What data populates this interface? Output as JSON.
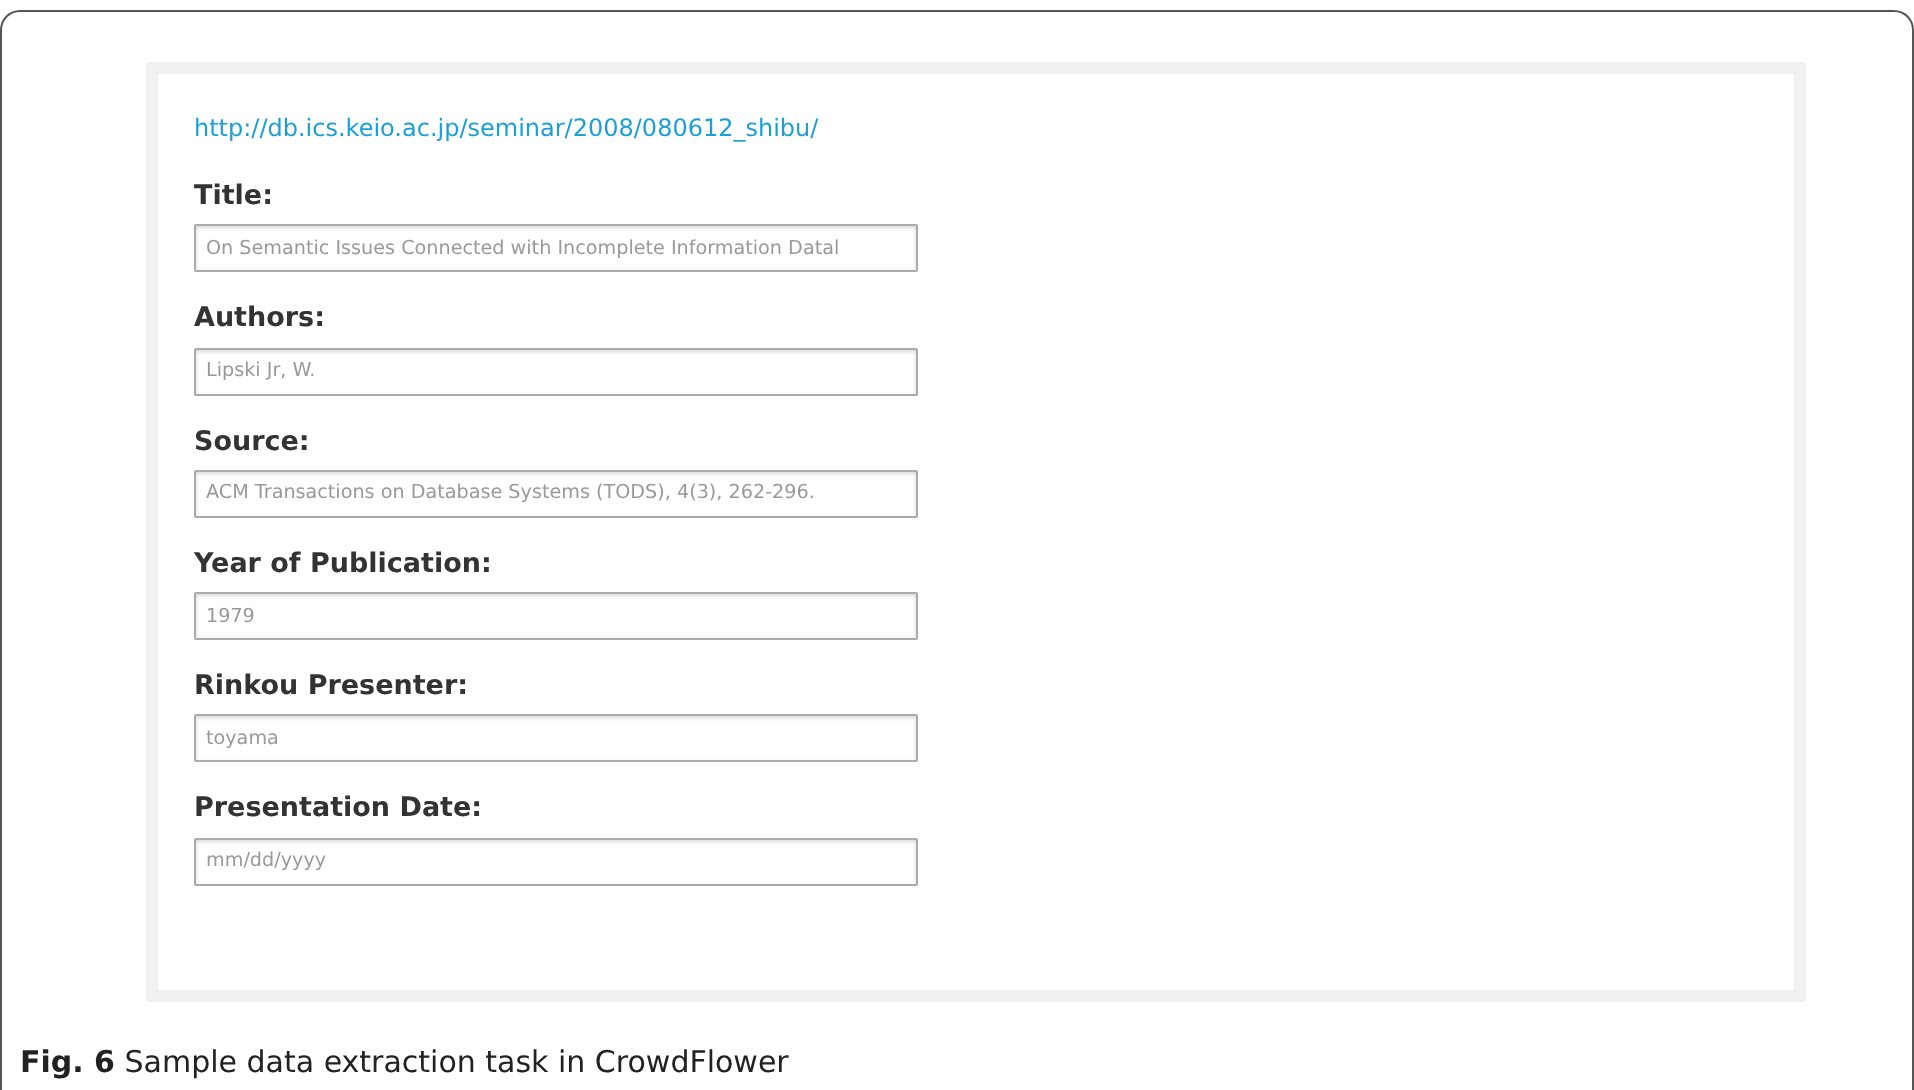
{
  "link": "http://db.ics.keio.ac.jp/seminar/2008/080612_shibu/",
  "fields": [
    {
      "label": "Title:",
      "placeholder": "On Semantic Issues Connected with Incomplete Information Datal"
    },
    {
      "label": "Authors:",
      "placeholder": "Lipski Jr, W."
    },
    {
      "label": "Source:",
      "placeholder": "ACM Transactions on Database Systems (TODS), 4(3), 262-296."
    },
    {
      "label": "Year of Publication:",
      "placeholder": "1979"
    },
    {
      "label": "Rinkou Presenter:",
      "placeholder": "toyama"
    },
    {
      "label": "Presentation Date:",
      "placeholder": "mm/dd/yyyy"
    }
  ],
  "caption": "**Fig. 6**  Sample data extraction task in CrowdFlower"
}
